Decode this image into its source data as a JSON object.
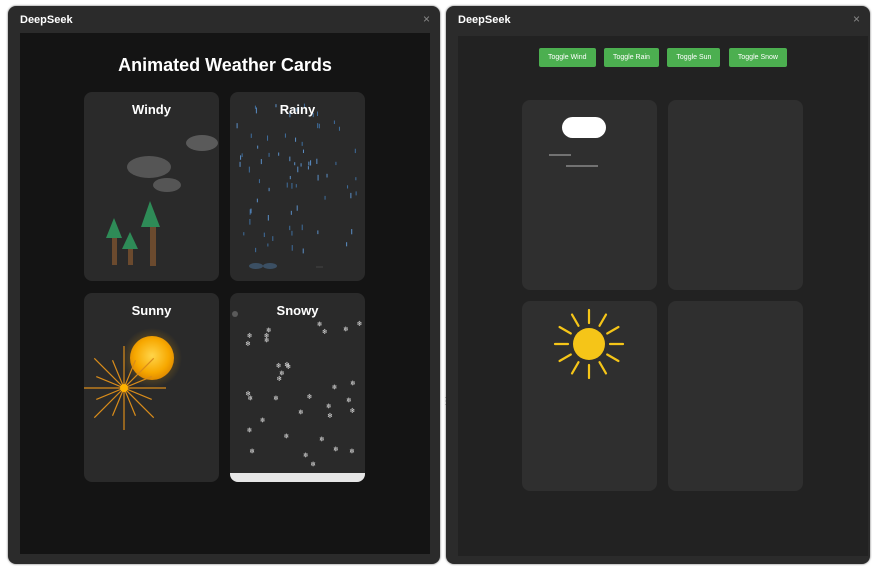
{
  "left_window": {
    "title": "DeepSeek",
    "close_glyph": "×",
    "heading": "Animated Weather Cards",
    "cards": [
      {
        "label": "Windy",
        "icon": "wind-clouds-trees"
      },
      {
        "label": "Rainy",
        "icon": "rain-drops"
      },
      {
        "label": "Sunny",
        "icon": "sun-rays"
      },
      {
        "label": "Snowy",
        "icon": "snowflakes"
      }
    ],
    "snowflake_glyph": "❄"
  },
  "right_window": {
    "title": "DeepSeek",
    "close_glyph": "×",
    "toggles": [
      "Toggle Wind",
      "Toggle Rain",
      "Toggle Sun",
      "Toggle Snow"
    ],
    "toggle_color": "#4caf50",
    "sun_color": "#f5c518"
  }
}
